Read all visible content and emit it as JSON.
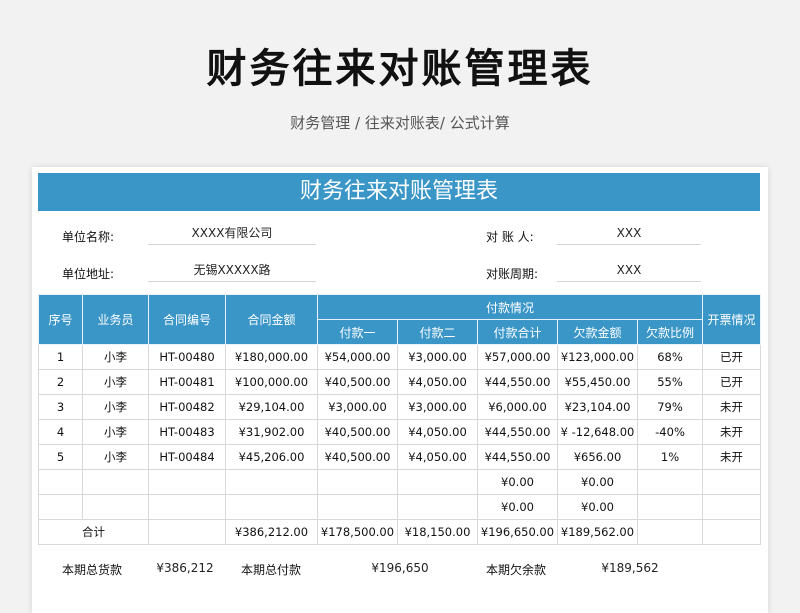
{
  "page": {
    "title": "财务往来对账管理表",
    "breadcrumb": "财务管理 / 往来对账表/ 公式计算"
  },
  "sheet": {
    "banner": "财务往来对账管理表",
    "info": {
      "unit_name_label": "单位名称:",
      "unit_name_value": "XXXX有限公司",
      "reconciler_label": "对 账 人:",
      "reconciler_value": "XXX",
      "unit_address_label": "单位地址:",
      "unit_address_value": "无锡XXXXX路",
      "period_label": "对账周期:",
      "period_value": "XXX"
    },
    "headers": {
      "seq": "序号",
      "salesperson": "业务员",
      "contract_no": "合同编号",
      "contract_amount": "合同金额",
      "payment_group": "付款情况",
      "payment1": "付款一",
      "payment2": "付款二",
      "payment_total": "付款合计",
      "owed": "欠款金额",
      "owed_ratio": "欠款比例",
      "invoice": "开票情况"
    },
    "rows": [
      {
        "seq": "1",
        "salesperson": "小李",
        "contract_no": "HT-00480",
        "contract_amount": "¥180,000.00",
        "payment1": "¥54,000.00",
        "payment2": "¥3,000.00",
        "payment_total": "¥57,000.00",
        "owed": "¥123,000.00",
        "owed_ratio": "68%",
        "invoice": "已开"
      },
      {
        "seq": "2",
        "salesperson": "小李",
        "contract_no": "HT-00481",
        "contract_amount": "¥100,000.00",
        "payment1": "¥40,500.00",
        "payment2": "¥4,050.00",
        "payment_total": "¥44,550.00",
        "owed": "¥55,450.00",
        "owed_ratio": "55%",
        "invoice": "已开"
      },
      {
        "seq": "3",
        "salesperson": "小李",
        "contract_no": "HT-00482",
        "contract_amount": "¥29,104.00",
        "payment1": "¥3,000.00",
        "payment2": "¥3,000.00",
        "payment_total": "¥6,000.00",
        "owed": "¥23,104.00",
        "owed_ratio": "79%",
        "invoice": "未开"
      },
      {
        "seq": "4",
        "salesperson": "小李",
        "contract_no": "HT-00483",
        "contract_amount": "¥31,902.00",
        "payment1": "¥40,500.00",
        "payment2": "¥4,050.00",
        "payment_total": "¥44,550.00",
        "owed": "¥ -12,648.00",
        "owed_ratio": "-40%",
        "invoice": "未开"
      },
      {
        "seq": "5",
        "salesperson": "小李",
        "contract_no": "HT-00484",
        "contract_amount": "¥45,206.00",
        "payment1": "¥40,500.00",
        "payment2": "¥4,050.00",
        "payment_total": "¥44,550.00",
        "owed": "¥656.00",
        "owed_ratio": "1%",
        "invoice": "未开"
      },
      {
        "seq": "",
        "salesperson": "",
        "contract_no": "",
        "contract_amount": "",
        "payment1": "",
        "payment2": "",
        "payment_total": "¥0.00",
        "owed": "¥0.00",
        "owed_ratio": "",
        "invoice": ""
      },
      {
        "seq": "",
        "salesperson": "",
        "contract_no": "",
        "contract_amount": "",
        "payment1": "",
        "payment2": "",
        "payment_total": "¥0.00",
        "owed": "¥0.00",
        "owed_ratio": "",
        "invoice": ""
      }
    ],
    "totals": {
      "label": "合计",
      "contract_amount": "¥386,212.00",
      "payment1": "¥178,500.00",
      "payment2": "¥18,150.00",
      "payment_total": "¥196,650.00",
      "owed": "¥189,562.00"
    },
    "summary": {
      "total_goods_label": "本期总货款",
      "total_goods_value": "¥386,212",
      "total_paid_label": "本期总付款",
      "total_paid_value": "¥196,650",
      "balance_label": "本期欠余款",
      "balance_value": "¥189,562"
    }
  }
}
